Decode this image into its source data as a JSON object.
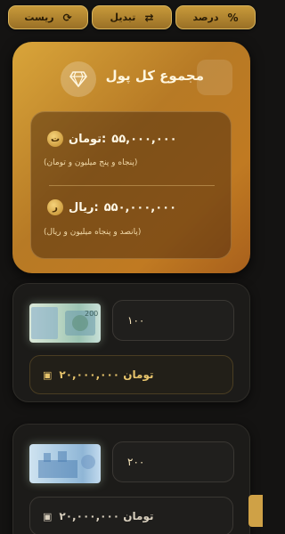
{
  "topbar": {
    "percent_label": "درصد",
    "percent_icon": "%",
    "convert_label": "تبدیل",
    "reset_label": "ریست"
  },
  "total": {
    "title": "مجموع کل پول",
    "toman_amount": "۵۵,۰۰۰,۰۰۰",
    "toman_unit": ":تومان",
    "toman_coin": "ت",
    "toman_words": "(پنجاه و پنج میلیون و تومان)",
    "rial_amount": "۵۵۰,۰۰۰,۰۰۰",
    "rial_unit": ":ریال",
    "rial_coin": "ر",
    "rial_words": "(پانصد و پنجاه میلیون و ریال)"
  },
  "notes": [
    {
      "quantity": "۱۰۰",
      "subtotal": "تومان ۲۰,۰۰۰,۰۰۰"
    },
    {
      "quantity": "۲۰۰",
      "subtotal": "تومان ۲۰,۰۰۰,۰۰۰"
    }
  ],
  "colors": {
    "gold": "#c89a3a",
    "background": "#141312"
  }
}
